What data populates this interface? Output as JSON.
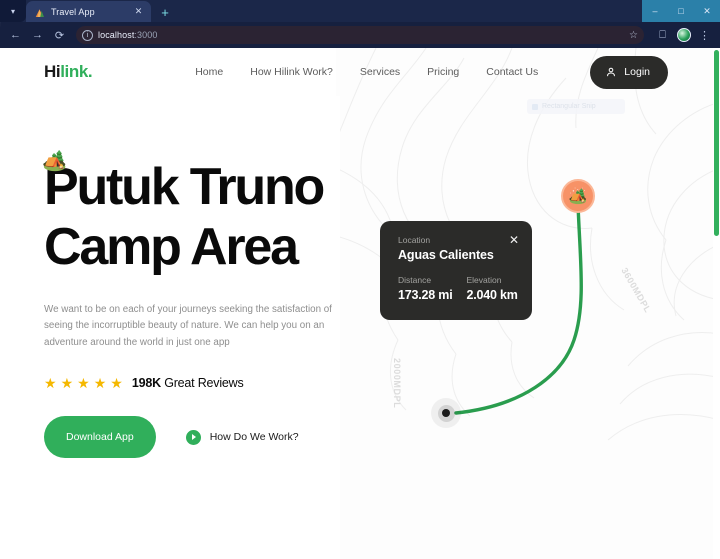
{
  "browser": {
    "tab": {
      "title": "Travel App",
      "favicon_icon": "camping-favicon",
      "close_icon": "close-icon"
    },
    "tab_list_chevron": "chevron-down-icon",
    "new_tab_icon": "plus-icon",
    "window_controls": {
      "minimize": "minimize-icon",
      "maximize": "maximize-icon",
      "close": "close-icon"
    },
    "toolbar": {
      "back_icon": "arrow-left-icon",
      "forward_icon": "arrow-right-icon",
      "reload_icon": "reload-icon",
      "site_info_icon": "info-icon",
      "url_host": "localhost",
      "url_port": ":3000",
      "url_full": "localhost:3000",
      "bookmark_icon": "star-icon",
      "split_screen_icon": "split-screen-icon",
      "profile_icon": "profile-globe-icon",
      "menu_icon": "more-vertical-icon"
    }
  },
  "nav": {
    "logo_primary": "Hi",
    "logo_accent": "link.",
    "links": [
      {
        "label": "Home"
      },
      {
        "label": "How Hilink Work?"
      },
      {
        "label": "Services"
      },
      {
        "label": "Pricing"
      },
      {
        "label": "Contact Us"
      }
    ],
    "login_label": "Login",
    "login_icon": "user-icon"
  },
  "overlay": {
    "snip_label": "Rectangular Snip"
  },
  "hero": {
    "emoji": "🏕️",
    "title": "Putuk Truno Camp Area",
    "description": "We want to be on each of your journeys seeking the satisfaction of seeing the incorruptible beauty of nature. We can help you on an adventure around the world in just one app",
    "stars": 5,
    "star_glyph": "★",
    "reviews_count": "198K",
    "reviews_label": "Great Reviews",
    "download_label": "Download App",
    "how_work_label": "How Do We Work?",
    "play_icon": "play-circle-icon"
  },
  "map": {
    "camp_marker_icon": "camping-marker-icon",
    "camp_marker_emoji": "🏕️",
    "start_marker_icon": "start-point-icon",
    "contour_labels": [
      "3600MDPL",
      "2000MDPL"
    ],
    "route_color": "#2a9d4e",
    "marker_color": "#f79267",
    "card": {
      "location_label": "Location",
      "location_value": "Aguas Calientes",
      "distance_label": "Distance",
      "distance_value": "173.28 mi",
      "elevation_label": "Elevation",
      "elevation_value": "2.040 km",
      "close_icon": "close-icon",
      "close_glyph": "✕"
    }
  },
  "colors": {
    "brand_green": "#30af5b",
    "dark_card": "#2b2b29",
    "star_yellow": "#f5b800",
    "marker_orange": "#f79267"
  },
  "scrollbar": {
    "name": "page-scrollbar"
  }
}
